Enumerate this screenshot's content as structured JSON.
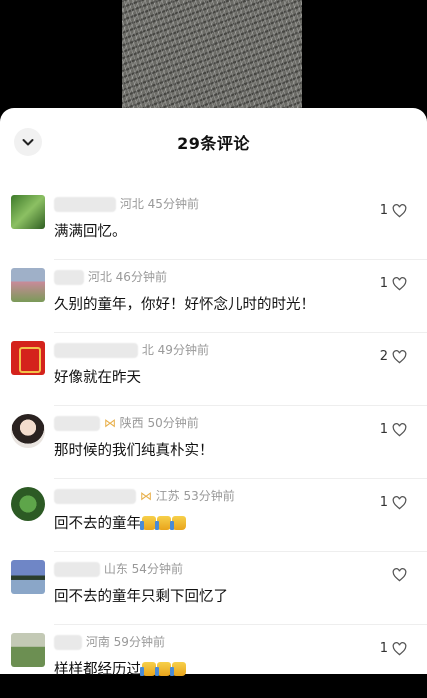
{
  "sheet": {
    "title": "29条评论"
  },
  "comments": [
    {
      "location": "河北",
      "time": "45分钟前",
      "text": "满满回忆。",
      "likes": "1"
    },
    {
      "location": "河北",
      "time": "46分钟前",
      "text": "久别的童年，你好！好怀念儿时的时光！",
      "likes": "1"
    },
    {
      "location": "北",
      "time": "49分钟前",
      "text": "好像就在昨天",
      "likes": "2"
    },
    {
      "location": "陕西",
      "time": "50分钟前",
      "text": "那时候的我们纯真朴实！",
      "likes": "1"
    },
    {
      "location": "江苏",
      "time": "53分钟前",
      "text": "回不去的童年",
      "likes": "1"
    },
    {
      "location": "山东",
      "time": "54分钟前",
      "text": "回不去的童年只剩下回忆了",
      "likes": ""
    },
    {
      "location": "河南",
      "time": "59分钟前",
      "text": "样样都经历过",
      "likes": "1"
    }
  ],
  "icons": {
    "collapse": "chevron-down-icon",
    "like": "heart-outline-icon",
    "thumbs": "thumbs-up-emoji"
  }
}
